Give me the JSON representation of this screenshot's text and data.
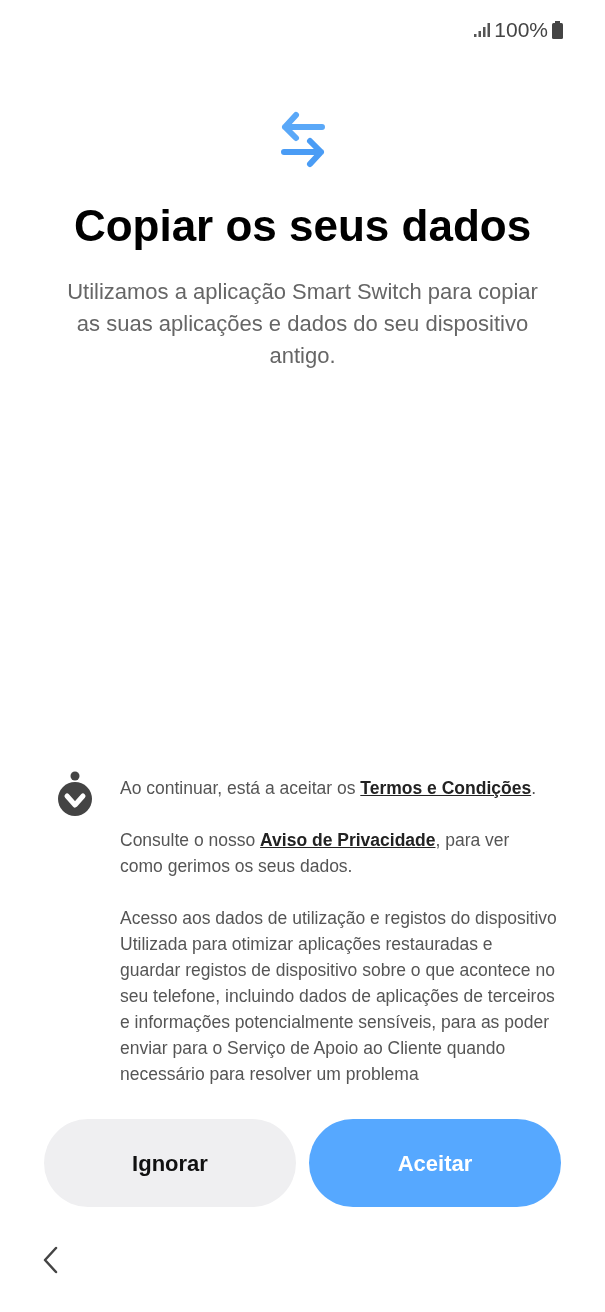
{
  "status_bar": {
    "battery": "100%"
  },
  "title": "Copiar os seus dados",
  "subtitle": "Utilizamos a aplicação Smart Switch para copiar as suas aplicações e dados do seu dispositivo antigo.",
  "notices": [
    {
      "parts": [
        {
          "kind": "text",
          "text": "Ao continuar, está a aceitar os "
        },
        {
          "kind": "link",
          "text": "Termos e Condições"
        },
        {
          "kind": "text",
          "text": "."
        }
      ]
    },
    {
      "parts": [
        {
          "kind": "text",
          "text": "Consulte o nosso "
        },
        {
          "kind": "link",
          "text": "Aviso de Privacidade"
        },
        {
          "kind": "text",
          "text": ", para ver como gerimos os seus dados."
        }
      ]
    }
  ],
  "usage": {
    "heading": "Acesso aos dados de utilização e registos do dispositivo",
    "body": "Utilizada para otimizar aplicações restauradas e guardar registos de dispositivo sobre o que acontece no seu telefone, incluindo dados de aplicações de terceiros e informações potencialmente sensíveis, para as poder enviar para o Serviço de Apoio ao Cliente quando necessário para resolver um problema"
  },
  "buttons": [
    {
      "label": "Ignorar",
      "kind": "secondary"
    },
    {
      "label": "Aceitar",
      "kind": "primary"
    }
  ]
}
